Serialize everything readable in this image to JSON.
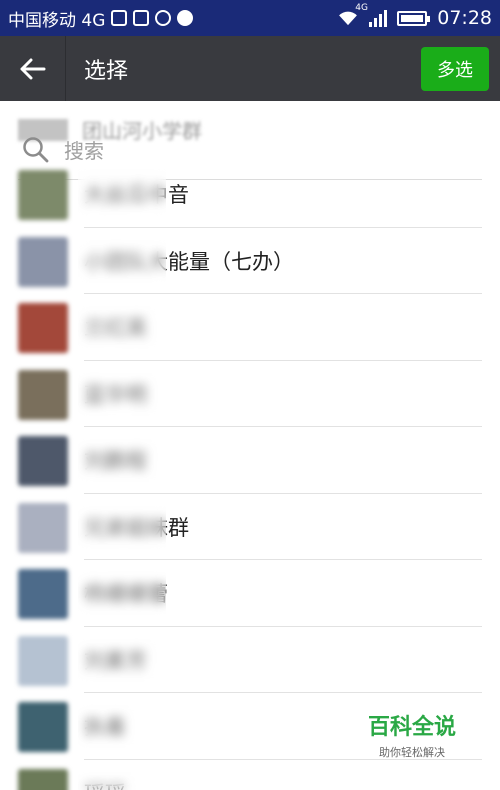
{
  "status_bar": {
    "carrier": "中国移动 4G",
    "time": "07:28",
    "network_tag": "4G"
  },
  "app_bar": {
    "title": "选择",
    "multi_select_label": "多选"
  },
  "search": {
    "placeholder": "搜索",
    "ghost_group": "团山河小学群"
  },
  "contacts": [
    {
      "name": "大丝瓜中音",
      "avatar_color": "#7d8a6a"
    },
    {
      "name": "小团队大能量（七办）",
      "avatar_color": "#8a93a8"
    },
    {
      "name": "兰红英",
      "avatar_color": "#a3483a"
    },
    {
      "name": "蓝华明",
      "avatar_color": "#7a6f5c"
    },
    {
      "name": "刘鹏程",
      "avatar_color": "#4e586a"
    },
    {
      "name": "兄弟姐妹群",
      "avatar_color": "#aab0c0"
    },
    {
      "name": "杨姗姗蕾",
      "avatar_color": "#4d6b8a"
    },
    {
      "name": "刘素芳",
      "avatar_color": "#b5c2d2"
    },
    {
      "name": "执着",
      "avatar_color": "#3e6270"
    },
    {
      "name": "瑶瑶",
      "avatar_color": "#6b7a58"
    }
  ],
  "watermark": {
    "main": "百科全说",
    "sub": "助你轻松解决"
  }
}
